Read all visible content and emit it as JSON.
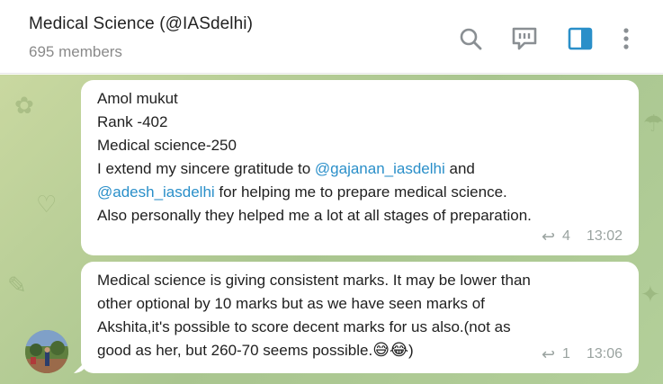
{
  "header": {
    "title": "Medical Science (@IASdelhi)",
    "subtitle": "695 members",
    "icons": [
      "search-icon",
      "comments-icon",
      "sidebar-toggle-icon",
      "more-vertical-icon"
    ],
    "accent": "#2a8fc9"
  },
  "messages": [
    {
      "lines": [
        "Amol mukut",
        "Rank -402",
        "Medical science-250"
      ],
      "line4_pre": "I extend my sincere gratitude to ",
      "mention1": "@gajanan_iasdelhi",
      "line4_post": " and",
      "mention2": "@adesh_iasdelhi",
      "line5_post": " for helping me to prepare medical science.",
      "line6": "Also personally they helped me a lot at all stages of preparation.",
      "replies": "4",
      "time": "13:02"
    },
    {
      "lines": [
        "Medical science is giving consistent marks. It may be lower than",
        "other optional by 10 marks but as we have seen marks of",
        "Akshita,it's possible to score decent marks for us also.(not as"
      ],
      "line4": "good as her, but 260-70 seems possible.",
      "emojis": "😅😂",
      "line4_end": ")",
      "replies": "1",
      "time": "13:06"
    }
  ]
}
